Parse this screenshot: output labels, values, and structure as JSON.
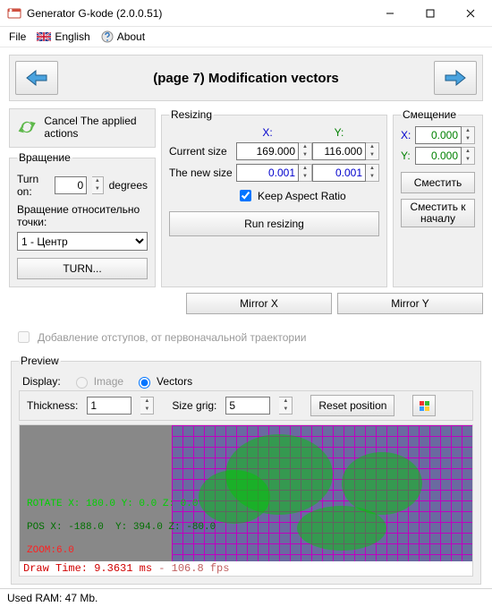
{
  "window": {
    "title": "Generator G-kode (2.0.0.51)"
  },
  "menu": {
    "file": "File",
    "english": "English",
    "about": "About"
  },
  "nav": {
    "page_title": "(page 7) Modification vectors"
  },
  "cancel_block": {
    "label": "Cancel The applied actions"
  },
  "rotation": {
    "group": "Вращение",
    "turn_on": "Turn on:",
    "value": "0",
    "degrees": "degrees",
    "pivot_label": "Вращение относительно точки:",
    "pivot_selected": "1 - Центр",
    "turn_btn": "TURN..."
  },
  "resize": {
    "group": "Resizing",
    "x": "X:",
    "y": "Y:",
    "current": "Current size",
    "cur_x": "169.000",
    "cur_y": "116.000",
    "newsize": "The new size",
    "new_x": "0.001",
    "new_y": "0.001",
    "keep_aspect": "Keep Aspect Ratio",
    "run_btn": "Run resizing"
  },
  "offset": {
    "group": "Смещение",
    "x": "X:",
    "y": "Y:",
    "xv": "0.000",
    "yv": "0.000",
    "shift_btn": "Сместить",
    "reset_btn": "Сместить к началу"
  },
  "mirror": {
    "x": "Mirror X",
    "y": "Mirror Y"
  },
  "addmargin": {
    "label": "Добавление отступов, от первоначальной траектории"
  },
  "preview": {
    "group": "Preview",
    "display": "Display:",
    "image": "Image",
    "vectors": "Vectors",
    "thickness": "Thickness:",
    "thickness_v": "1",
    "sizegrid": "Size grig:",
    "sizegrid_v": "5",
    "reset_btn": "Reset position",
    "overlays": {
      "rotate": "ROTATE X: 180.0 Y: 0.0 Z: 0.0",
      "pos": "POS X: -188.0  Y: 394.0 Z: -80.0",
      "zoom": "ZOOM:6.0",
      "draw_a": "Draw Time: 9.3631 ms",
      "draw_b": " - 106.8 fps"
    }
  },
  "status": {
    "usedram": "Used RAM:  47  Mb."
  }
}
